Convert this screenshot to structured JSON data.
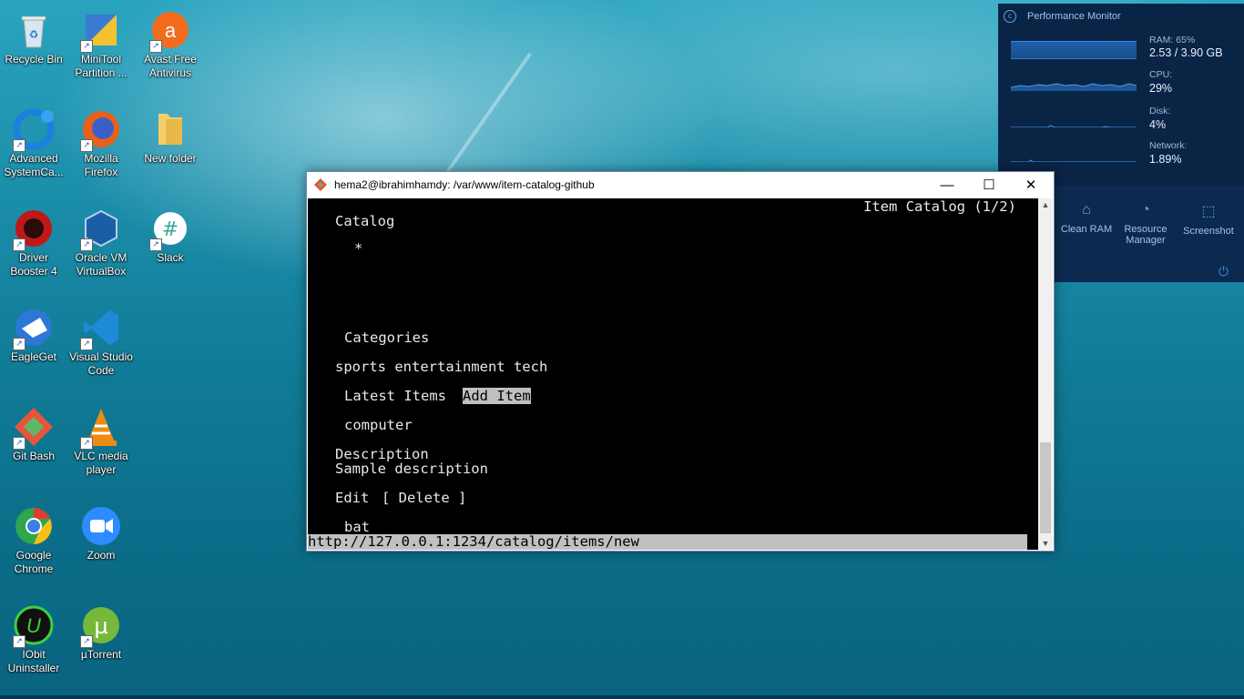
{
  "desktop": {
    "icons": [
      {
        "label": "Recycle Bin"
      },
      {
        "label": "MiniTool Partition ..."
      },
      {
        "label": "Avast Free Antivirus"
      },
      {
        "label": "Advanced SystemCa..."
      },
      {
        "label": "Mozilla Firefox"
      },
      {
        "label": "New folder"
      },
      {
        "label": "Driver Booster 4"
      },
      {
        "label": "Oracle VM VirtualBox"
      },
      {
        "label": "Slack"
      },
      {
        "label": "EagleGet"
      },
      {
        "label": "Visual Studio Code"
      },
      {
        "label": "Git Bash"
      },
      {
        "label": "VLC media player"
      },
      {
        "label": "Google Chrome"
      },
      {
        "label": "Zoom"
      },
      {
        "label": "IObit Uninstaller"
      },
      {
        "label": "µTorrent"
      }
    ]
  },
  "window": {
    "title": "hema2@ibrahimhamdy: /var/www/item-catalog-github",
    "minimize": "—",
    "maximize": "☐",
    "close": "✕"
  },
  "terminal": {
    "page_indicator": "Item Catalog (1/2)",
    "lines": {
      "catalog": "Catalog",
      "star": "*",
      "categories_heading": "Categories",
      "categories": "sports entertainment tech",
      "latest_items": "Latest Items",
      "add_item": "Add Item",
      "item1": "computer",
      "description_label": "Description",
      "description_value": "Sample description",
      "edit": "Edit",
      "delete": "[ Delete ]",
      "item2": "bat"
    },
    "status_url": "http://127.0.0.1:1234/catalog/items/new"
  },
  "perf_monitor": {
    "title": "Performance Monitor",
    "ram_label": "RAM: 65%",
    "ram_value": "2.53 / 3.90 GB",
    "cpu_label": "CPU:",
    "cpu_value": "29%",
    "disk_label": "Disk:",
    "disk_value": "4%",
    "network_label": "Network:",
    "network_value": "1.89%",
    "tools": [
      "Clean RAM",
      "Resource Manager",
      "Screenshot"
    ]
  }
}
